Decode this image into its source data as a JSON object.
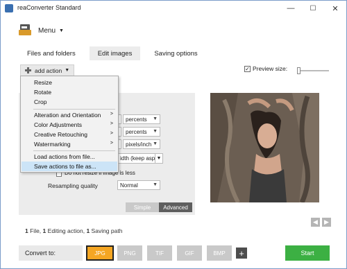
{
  "window": {
    "title": "reaConverter Standard",
    "controls": [
      "—",
      "☐",
      "✕"
    ]
  },
  "menu": {
    "label": "Menu"
  },
  "tabs": [
    {
      "label": "Files and folders",
      "active": false
    },
    {
      "label": "Edit images",
      "active": true
    },
    {
      "label": "Saving options",
      "active": false
    }
  ],
  "toolbar": {
    "add_action_label": "add action",
    "preview_label": "Preview size:",
    "preview_checked": true,
    "preview_level": 0
  },
  "dropdown": {
    "items": [
      {
        "label": "Resize",
        "submenu": false
      },
      {
        "label": "Rotate",
        "submenu": false
      },
      {
        "label": "Crop",
        "submenu": false
      },
      {
        "label": "Alteration and Orientation",
        "submenu": true
      },
      {
        "label": "Color Adjustments",
        "submenu": true
      },
      {
        "label": "Creative Retouching",
        "submenu": true
      },
      {
        "label": "Watermarking",
        "submenu": true
      },
      {
        "label": "Load actions from file...",
        "submenu": false
      },
      {
        "label": "Save actions to file as...",
        "submenu": false,
        "highlighted": true
      }
    ]
  },
  "panel": {
    "unit_select_1": "percents",
    "unit_select_2": "percents",
    "unit_select_3": "pixels/inch",
    "fit_select": "idth (keep asp",
    "do_not_resize_label": "Do not resize if image is less",
    "resampling_label": "Resampling quality",
    "resampling_value": "Normal",
    "mode_simple": "Simple",
    "mode_advanced": "Advanced"
  },
  "status": {
    "files_count": "1",
    "files_label": "File,",
    "editing_count": "1",
    "editing_label": "Editing action,",
    "saving_count": "1",
    "saving_label": "Saving path"
  },
  "bottom": {
    "convert_label": "Convert to:",
    "formats": [
      {
        "label": "JPG",
        "active": true
      },
      {
        "label": "PNG",
        "active": false
      },
      {
        "label": "TIF",
        "active": false
      },
      {
        "label": "GIF",
        "active": false
      },
      {
        "label": "BMP",
        "active": false
      }
    ],
    "add_format_label": "+",
    "start_label": "Start"
  },
  "colors": {
    "accent_orange": "#f5a623",
    "start_green": "#3cb043",
    "highlight_blue": "#cce4f7"
  }
}
